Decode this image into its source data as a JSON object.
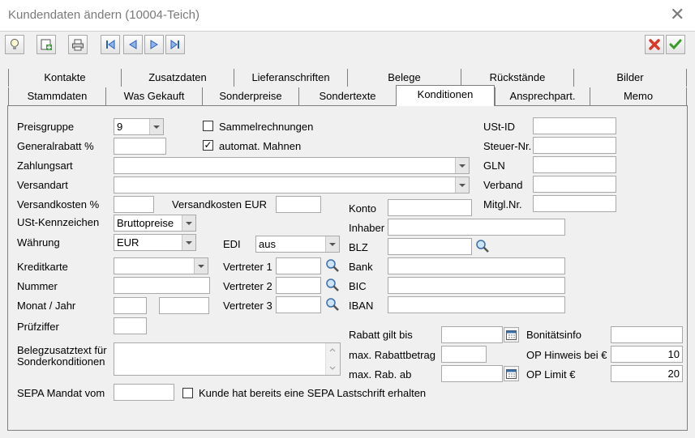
{
  "window": {
    "title": "Kundendaten ändern (10004-Teich)",
    "close_glyph": "✕"
  },
  "toolbar": {
    "buttons": [
      "lightbulb-icon",
      "new-record-icon",
      "print-icon",
      "first-record-icon",
      "prev-record-icon",
      "next-record-icon",
      "last-record-icon"
    ],
    "cancel_icon": "red-x-icon",
    "ok_icon": "green-check-icon"
  },
  "tabs_back": [
    "Kontakte",
    "Zusatzdaten",
    "Lieferanschriften",
    "Belege",
    "Rückstände",
    "Bilder"
  ],
  "tabs_front": [
    "Stammdaten",
    "Was Gekauft",
    "Sonderpreise",
    "Sondertexte",
    "Konditionen",
    "Ansprechpart.",
    "Memo"
  ],
  "active_tab": "Konditionen",
  "form": {
    "preisgruppe": {
      "label": "Preisgruppe",
      "value": "9"
    },
    "generalrabatt": {
      "label": "Generalrabatt %",
      "value": ""
    },
    "sammelrechnungen": {
      "label": "Sammelrechnungen",
      "checked": false
    },
    "automat_mahnen": {
      "label": "automat. Mahnen",
      "checked": true,
      "mark": "✓"
    },
    "zahlungsart": {
      "label": "Zahlungsart",
      "value": ""
    },
    "versandart": {
      "label": "Versandart",
      "value": ""
    },
    "versandkosten_pct": {
      "label": "Versandkosten %",
      "value": ""
    },
    "versandkosten_eur": {
      "label": "Versandkosten EUR",
      "value": ""
    },
    "ust_kennzeichen": {
      "label": "USt-Kennzeichen",
      "value": "Bruttopreise"
    },
    "waehrung": {
      "label": "Währung",
      "value": "EUR"
    },
    "edi": {
      "label": "EDI",
      "value": "aus"
    },
    "kreditkarte": {
      "label": "Kreditkarte",
      "value": ""
    },
    "nummer": {
      "label": "Nummer",
      "value": ""
    },
    "monat_jahr": {
      "label": "Monat / Jahr",
      "value1": "",
      "value2": ""
    },
    "pruefziffer": {
      "label": "Prüfziffer",
      "value": ""
    },
    "belegzusatztext": {
      "label": "Belegzusatztext für Sonderkonditionen",
      "value": ""
    },
    "sepa_mandat": {
      "label": "SEPA Mandat vom",
      "value": ""
    },
    "sepa_lastschrift": {
      "label": "Kunde hat bereits eine SEPA Lastschrift erhalten",
      "checked": false
    },
    "vertreter1": {
      "label": "Vertreter 1",
      "value": ""
    },
    "vertreter2": {
      "label": "Vertreter 2",
      "value": ""
    },
    "vertreter3": {
      "label": "Vertreter 3",
      "value": ""
    },
    "konto": {
      "label": "Konto",
      "value": ""
    },
    "inhaber": {
      "label": "Inhaber",
      "value": ""
    },
    "blz": {
      "label": "BLZ",
      "value": ""
    },
    "bank": {
      "label": "Bank",
      "value": ""
    },
    "bic": {
      "label": "BIC",
      "value": ""
    },
    "iban": {
      "label": "IBAN",
      "value": ""
    },
    "ust_id": {
      "label": "USt-ID",
      "value": ""
    },
    "steuer_nr": {
      "label": "Steuer-Nr.",
      "value": ""
    },
    "gln": {
      "label": "GLN",
      "value": ""
    },
    "verband": {
      "label": "Verband",
      "value": ""
    },
    "mitgl_nr": {
      "label": "Mitgl.Nr.",
      "value": ""
    },
    "rabatt_gilt_bis": {
      "label": "Rabatt gilt bis",
      "value": ""
    },
    "max_rabattbetrag": {
      "label": "max. Rabattbetrag",
      "value": ""
    },
    "max_rab_ab": {
      "label": "max. Rab. ab",
      "value": ""
    },
    "bonitaetsinfo": {
      "label": "Bonitätsinfo",
      "value": ""
    },
    "op_hinweis": {
      "label": "OP Hinweis bei €",
      "value": "10"
    },
    "op_limit": {
      "label": "OP Limit €",
      "value": "20"
    }
  },
  "colors": {
    "cancel": "#d83a2a",
    "ok": "#3a9a2a",
    "nav": "#2b5fb8"
  }
}
